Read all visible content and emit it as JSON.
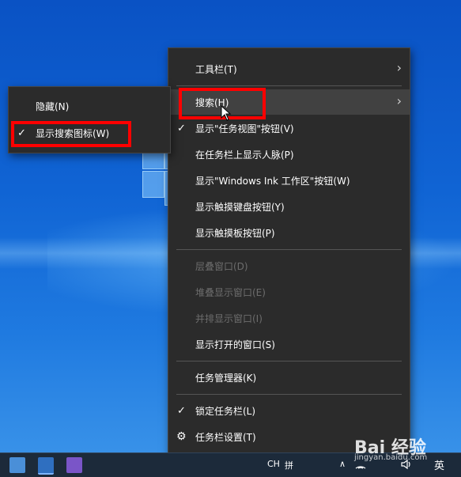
{
  "colors": {
    "menu_bg": "#2b2b2b",
    "highlight": "#414141",
    "disabled_text": "#6d6d6d",
    "annotation_red": "#ff0000",
    "desktop_blue": "#1064d4"
  },
  "context_menu": {
    "items": [
      {
        "label": "工具栏(T)",
        "icon": "chevron-right-icon"
      },
      {
        "label": "搜索(H)",
        "icon": "chevron-right-icon",
        "highlighted": true
      },
      {
        "label": "显示\"任务视图\"按钮(V)",
        "checked": true
      },
      {
        "label": "在任务栏上显示人脉(P)"
      },
      {
        "label": "显示\"Windows Ink 工作区\"按钮(W)"
      },
      {
        "label": "显示触摸键盘按钮(Y)"
      },
      {
        "label": "显示触摸板按钮(P)"
      },
      {
        "label": "层叠窗口(D)",
        "disabled": true
      },
      {
        "label": "堆叠显示窗口(E)",
        "disabled": true
      },
      {
        "label": "并排显示窗口(I)",
        "disabled": true
      },
      {
        "label": "显示打开的窗口(S)"
      },
      {
        "label": "任务管理器(K)"
      },
      {
        "label": "锁定任务栏(L)",
        "checked": true
      },
      {
        "label": "任务栏设置(T)",
        "icon": "gear-icon"
      }
    ]
  },
  "search_submenu": {
    "items": [
      {
        "label": "隐藏(N)"
      },
      {
        "label": "显示搜索图标(W)",
        "checked": true
      }
    ]
  },
  "glyphs": {
    "check": "✓",
    "chevron": "›",
    "gear": "⚙"
  },
  "taskbar": {
    "ime": "CH",
    "ime_grid": "拼",
    "tray_chevron": "∧",
    "lang": "英"
  },
  "watermark": {
    "text": "Bai 经验",
    "url": "jingyan.baidu.com"
  }
}
